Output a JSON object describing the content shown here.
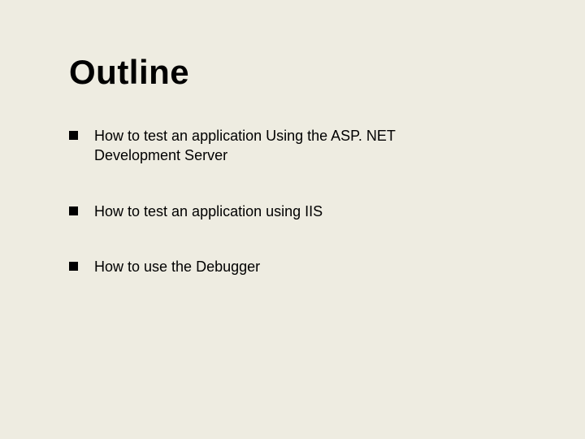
{
  "title": "Outline",
  "bullets": [
    {
      "text": "How to test an application Using the ASP. NET Development Server"
    },
    {
      "text": "How to test an application using IIS"
    },
    {
      "text": "How to use the Debugger"
    }
  ]
}
